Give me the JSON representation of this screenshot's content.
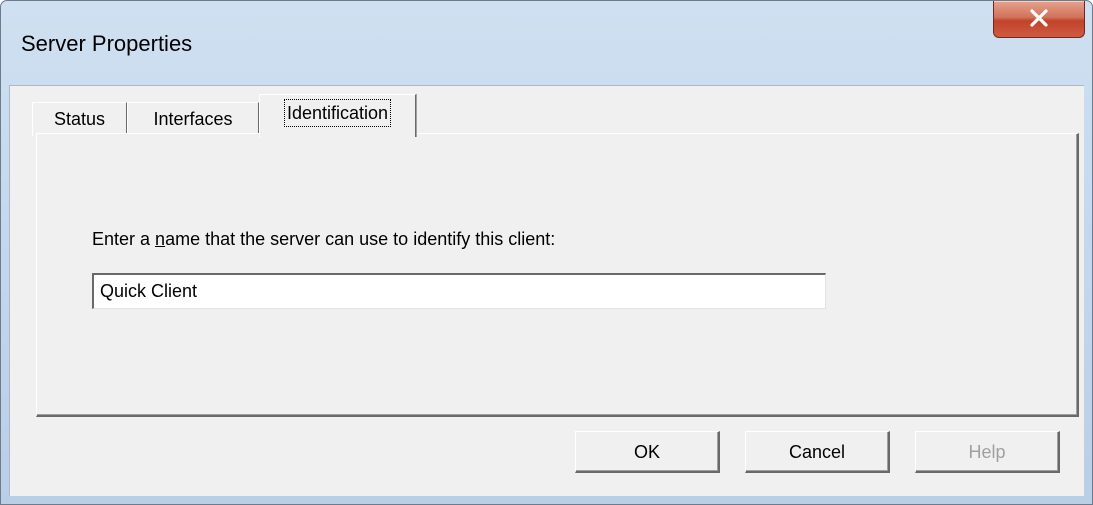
{
  "window": {
    "title": "Server Properties",
    "close_label": "close"
  },
  "tabs": [
    {
      "label": "Status",
      "selected": false
    },
    {
      "label": "Interfaces",
      "selected": false
    },
    {
      "label": "Identification",
      "selected": true
    }
  ],
  "identification": {
    "prompt_before": "Enter a ",
    "prompt_mnemonic": "n",
    "prompt_after": "ame that the server can use to identify this client:",
    "name_value": "Quick Client"
  },
  "buttons": {
    "ok": "OK",
    "cancel": "Cancel",
    "help": "Help",
    "help_enabled": false
  },
  "colors": {
    "close_button": "#c1432b",
    "dialog_face": "#f0f0f0",
    "frame": "#c2d6ec"
  }
}
